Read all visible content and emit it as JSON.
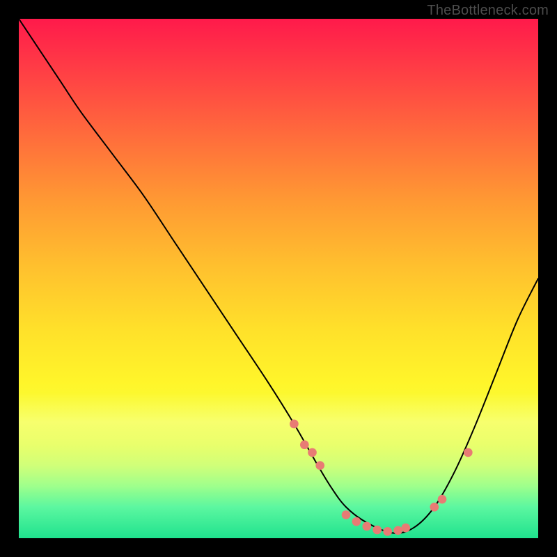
{
  "watermark": "TheBottleneck.com",
  "chart_data": {
    "type": "line",
    "title": "",
    "xlabel": "",
    "ylabel": "",
    "xlim": [
      0,
      100
    ],
    "ylim": [
      0,
      100
    ],
    "series": [
      {
        "name": "bottleneck-curve",
        "x": [
          0,
          4,
          8,
          12,
          18,
          24,
          30,
          36,
          42,
          48,
          53,
          57,
          60,
          63,
          67,
          72,
          76,
          80,
          84,
          88,
          92,
          96,
          100
        ],
        "y": [
          100,
          94,
          88,
          82,
          74,
          66,
          57,
          48,
          39,
          30,
          22,
          15,
          10,
          6,
          3,
          1,
          2,
          6,
          13,
          22,
          32,
          42,
          50
        ]
      }
    ],
    "markers": {
      "name": "highlight-dots",
      "x": [
        53,
        55,
        56.5,
        58,
        63,
        65,
        67,
        69,
        71,
        73,
        74.5,
        80,
        81.5,
        86.5
      ],
      "y": [
        22,
        18,
        16.5,
        14,
        4.5,
        3.2,
        2.3,
        1.6,
        1.3,
        1.5,
        2.0,
        6.0,
        7.5,
        16.5
      ]
    },
    "background": {
      "type": "vertical-gradient",
      "stops": [
        {
          "pos": 0,
          "color": "#ff1a4b"
        },
        {
          "pos": 35,
          "color": "#ff9933"
        },
        {
          "pos": 70,
          "color": "#fff52a"
        },
        {
          "pos": 100,
          "color": "#1fe28e"
        }
      ]
    }
  }
}
